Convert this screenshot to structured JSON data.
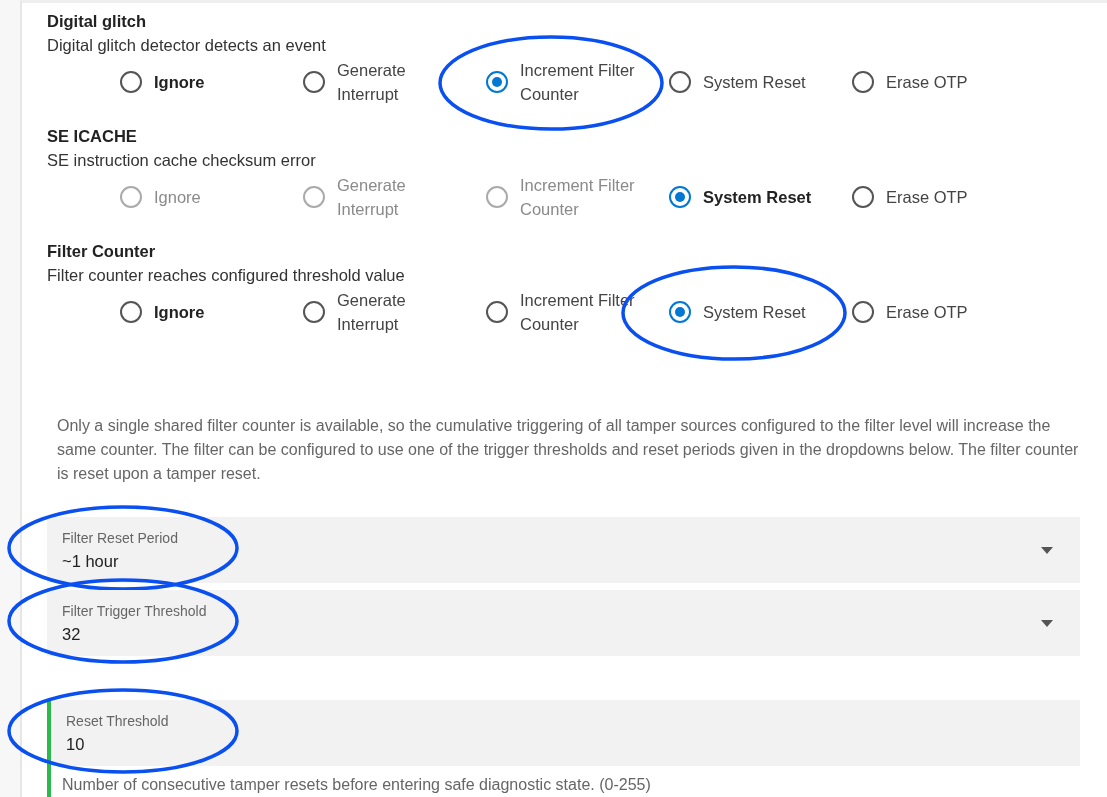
{
  "sections": [
    {
      "title": "Digital glitch",
      "description": "Digital glitch detector detects an event",
      "options": [
        {
          "label": "Ignore",
          "selected": false,
          "default": true,
          "disabled": false,
          "circled": false
        },
        {
          "label": "Generate Interrupt",
          "selected": false,
          "default": false,
          "disabled": false,
          "circled": false
        },
        {
          "label": "Increment Filter Counter",
          "selected": true,
          "default": false,
          "disabled": false,
          "circled": true
        },
        {
          "label": "System Reset",
          "selected": false,
          "default": false,
          "disabled": false,
          "circled": false
        },
        {
          "label": "Erase OTP",
          "selected": false,
          "default": false,
          "disabled": false,
          "circled": false
        }
      ]
    },
    {
      "title": "SE ICACHE",
      "description": "SE instruction cache checksum error",
      "options": [
        {
          "label": "Ignore",
          "selected": false,
          "default": false,
          "disabled": true,
          "circled": false
        },
        {
          "label": "Generate Interrupt",
          "selected": false,
          "default": false,
          "disabled": true,
          "circled": false
        },
        {
          "label": "Increment Filter Counter",
          "selected": false,
          "default": false,
          "disabled": true,
          "circled": false
        },
        {
          "label": "System Reset",
          "selected": true,
          "default": true,
          "disabled": false,
          "circled": false
        },
        {
          "label": "Erase OTP",
          "selected": false,
          "default": false,
          "disabled": false,
          "circled": false
        }
      ]
    },
    {
      "title": "Filter Counter",
      "description": "Filter counter reaches configured threshold value",
      "options": [
        {
          "label": "Ignore",
          "selected": false,
          "default": true,
          "disabled": false,
          "circled": false
        },
        {
          "label": "Generate Interrupt",
          "selected": false,
          "default": false,
          "disabled": false,
          "circled": false
        },
        {
          "label": "Increment Filter Counter",
          "selected": false,
          "default": false,
          "disabled": false,
          "circled": false
        },
        {
          "label": "System Reset",
          "selected": true,
          "default": false,
          "disabled": false,
          "circled": true
        },
        {
          "label": "Erase OTP",
          "selected": false,
          "default": false,
          "disabled": false,
          "circled": false
        }
      ]
    }
  ],
  "info": "Only a single shared filter counter is available, so the cumulative triggering of all tamper sources configured to the filter level will increase the same counter. The filter can be configured to use one of the trigger thresholds and reset periods given in the dropdowns below. The filter counter is reset upon a tamper reset.",
  "dropdowns": [
    {
      "label": "Filter Reset Period",
      "value": "~1 hour",
      "circled": true
    },
    {
      "label": "Filter Trigger Threshold",
      "value": "32",
      "circled": true
    }
  ],
  "reset_threshold": {
    "label": "Reset Threshold",
    "value": "10",
    "circled": true,
    "valid": true,
    "helper": "Number of consecutive tamper resets before entering safe diagnostic state. (0-255)"
  }
}
